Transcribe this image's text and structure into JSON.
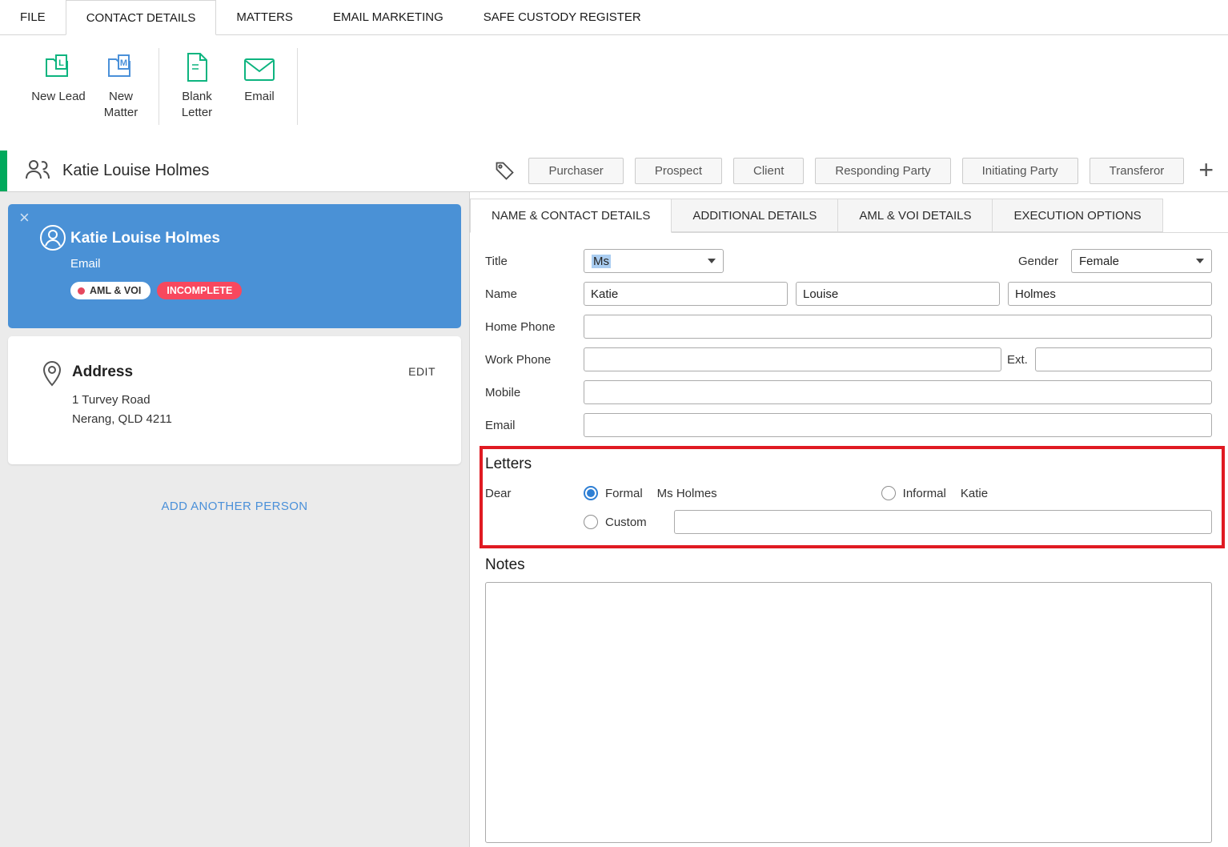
{
  "colors": {
    "accent_green": "#00a95c",
    "icon_green": "#0db47f",
    "icon_blue": "#4a90d9",
    "card_blue": "#4a91d6",
    "link_blue": "#4a90d9",
    "danger_pink": "#f8485e",
    "annotation_red": "#e01a22",
    "radio_blue": "#2e7fd4"
  },
  "annotation": {
    "type": "highlight-box",
    "target": "letters-section",
    "color": "#e01a22"
  },
  "menu_tabs": [
    {
      "label": "FILE"
    },
    {
      "label": "CONTACT DETAILS"
    },
    {
      "label": "MATTERS"
    },
    {
      "label": "EMAIL MARKETING"
    },
    {
      "label": "SAFE CUSTODY REGISTER"
    }
  ],
  "ribbon": {
    "buttons": [
      {
        "label": "New Lead"
      },
      {
        "label": "New Matter"
      },
      {
        "label": "Blank Letter"
      },
      {
        "label": "Email"
      }
    ]
  },
  "contact_header": {
    "name": "Katie Louise Holmes",
    "roles": [
      "Purchaser",
      "Prospect",
      "Client",
      "Responding Party",
      "Initiating Party",
      "Transferor"
    ],
    "add_label": "+"
  },
  "sidebar": {
    "person_card": {
      "name": "Katie Louise Holmes",
      "subtitle": "Email",
      "badge_aml": "AML & VOI",
      "badge_incomplete": "INCOMPLETE",
      "close_glyph": "×"
    },
    "address_card": {
      "title": "Address",
      "edit_label": "EDIT",
      "line1": "1 Turvey Road",
      "line2": "Nerang, QLD 4211"
    },
    "add_person_label": "ADD ANOTHER PERSON"
  },
  "detail_tabs": [
    {
      "label": "NAME & CONTACT DETAILS"
    },
    {
      "label": "ADDITIONAL DETAILS"
    },
    {
      "label": "AML & VOI DETAILS"
    },
    {
      "label": "EXECUTION OPTIONS"
    }
  ],
  "form": {
    "title_label": "Title",
    "title_value": "Ms",
    "gender_label": "Gender",
    "gender_value": "Female",
    "name_label": "Name",
    "first_name": "Katie",
    "middle_name": "Louise",
    "last_name": "Holmes",
    "home_phone_label": "Home Phone",
    "home_phone_value": "",
    "work_phone_label": "Work Phone",
    "work_phone_value": "",
    "ext_label": "Ext.",
    "ext_value": "",
    "mobile_label": "Mobile",
    "mobile_value": "",
    "email_label": "Email",
    "email_value": "",
    "letters": {
      "heading": "Letters",
      "dear_label": "Dear",
      "formal_label": "Formal",
      "formal_value": "Ms Holmes",
      "informal_label": "Informal",
      "informal_value": "Katie",
      "custom_label": "Custom",
      "custom_value": "",
      "selected": "formal"
    },
    "notes_heading": "Notes",
    "notes_value": ""
  }
}
